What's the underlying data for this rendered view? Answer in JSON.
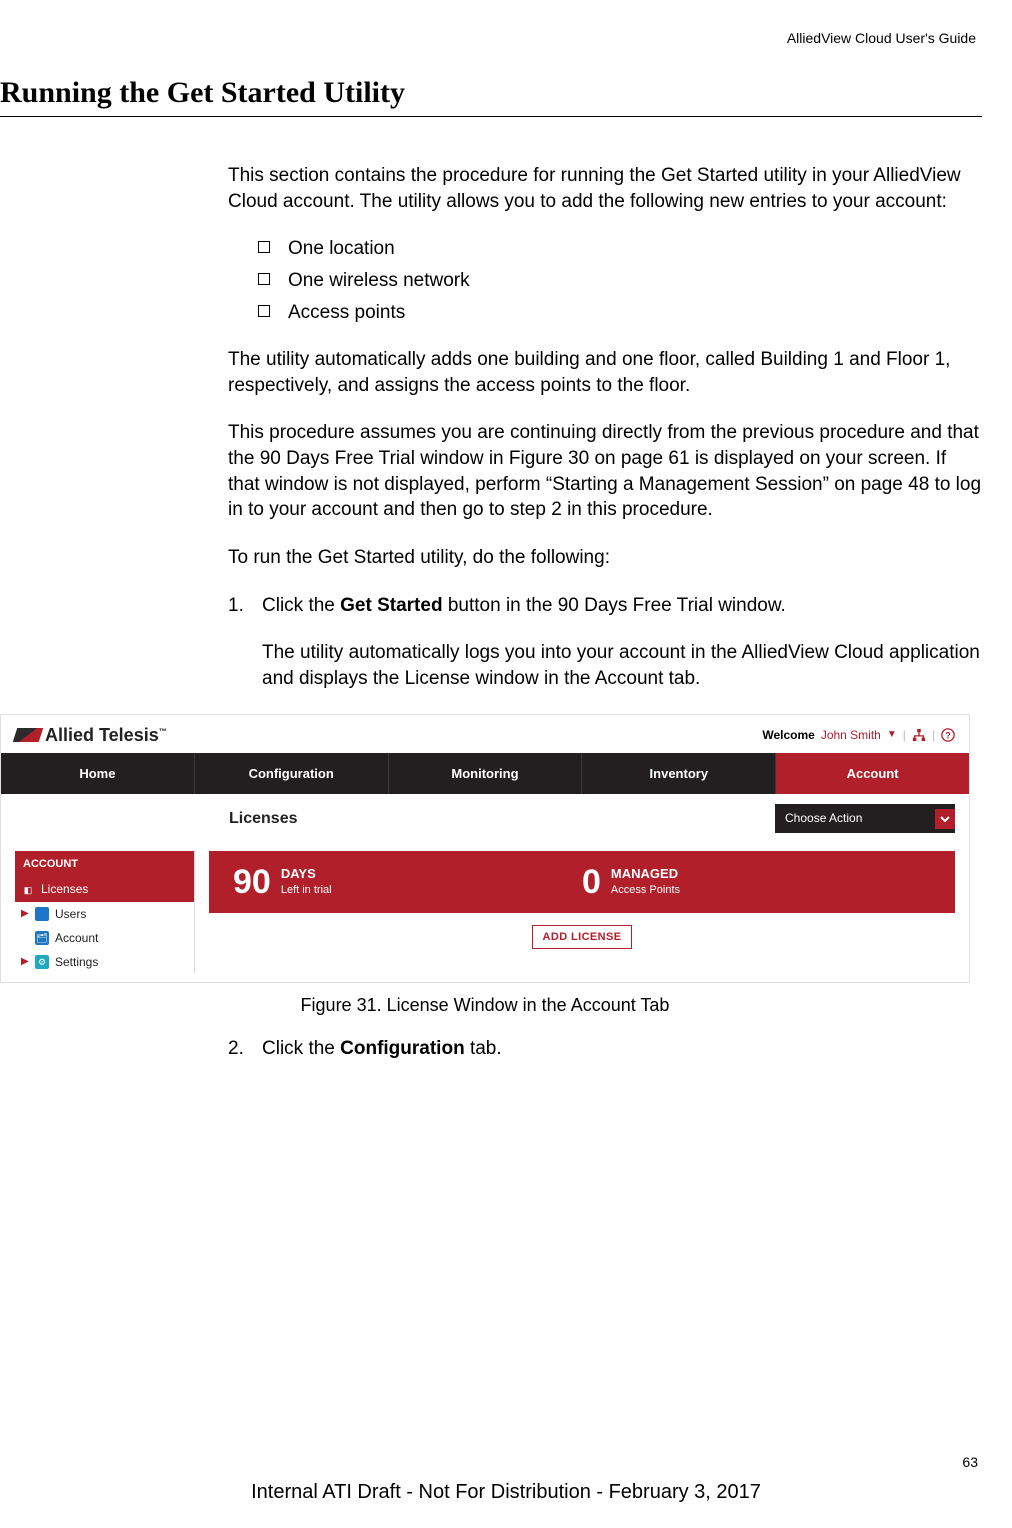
{
  "doc": {
    "header": "AlliedView Cloud User's Guide",
    "heading": "Running the Get Started Utility",
    "intro": "This section contains the procedure for running the Get Started utility in your AlliedView Cloud account. The utility allows you to add the following new entries to your account:",
    "bullets": [
      "One location",
      "One wireless network",
      "Access points"
    ],
    "para2": "The utility automatically adds one building and one floor, called Building 1 and Floor 1, respectively, and assigns the access points to the floor.",
    "para3": "This procedure assumes you are continuing directly from the previous procedure and that the 90 Days Free Trial window in Figure 30 on page 61 is displayed on your screen. If that window is not displayed, perform “Starting a Management Session” on page 48 to log in to your account and then go to step 2 in this procedure.",
    "para4": "To run the Get Started utility, do the following:",
    "steps": [
      {
        "num": "1.",
        "text_a": "Click the ",
        "bold_a": "Get Started",
        "text_b": " button in the 90 Days Free Trial window.",
        "sub": "The utility automatically logs you into your account in the AlliedView Cloud application and displays the License window in the Account tab."
      },
      {
        "num": "2.",
        "text_a": "Click the ",
        "bold_a": "Configuration",
        "text_b": " tab.",
        "sub": ""
      }
    ],
    "figure_caption": "Figure 31. License Window in the Account Tab",
    "page_num": "63",
    "footer": "Internal ATI Draft - Not For Distribution - February 3, 2017"
  },
  "app": {
    "brand": "Allied Telesis",
    "welcome_label": "Welcome",
    "user": "John Smith",
    "nav": [
      "Home",
      "Configuration",
      "Monitoring",
      "Inventory",
      "Account"
    ],
    "sub_title": "Licenses",
    "choose_action": "Choose Action",
    "sidebar": {
      "head": "ACCOUNT",
      "items": [
        "Licenses",
        "Users",
        "Account",
        "Settings"
      ]
    },
    "banner": {
      "days_num": "90",
      "days_l1": "DAYS",
      "days_l2": "Left in trial",
      "ap_num": "0",
      "ap_l1": "MANAGED",
      "ap_l2": "Access Points"
    },
    "add_license": "ADD LICENSE"
  }
}
